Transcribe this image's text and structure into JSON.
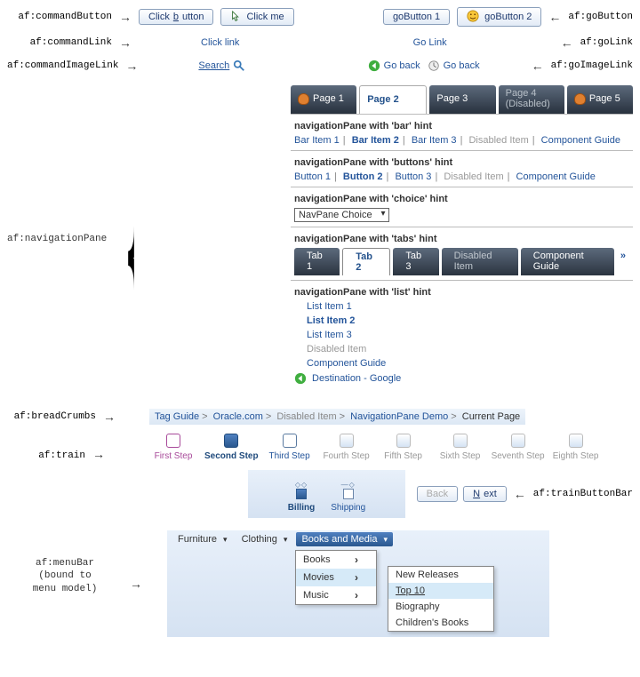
{
  "labels": {
    "commandButton": "af:commandButton",
    "goButton": "af:goButton",
    "commandLink": "af:commandLink",
    "goLink": "af:goLink",
    "commandImageLink": "af:commandImageLink",
    "goImageLink": "af:goImageLink",
    "navigationPane": "af:navigationPane",
    "breadCrumbs": "af:breadCrumbs",
    "train": "af:train",
    "trainButtonBar": "af:trainButtonBar",
    "menuBar_l1": "af:menuBar",
    "menuBar_l2": "(bound to",
    "menuBar_l3": "menu model)"
  },
  "row1": {
    "btn1_pre": "Click ",
    "btn1_u": "b",
    "btn1_post": "utton",
    "btn2": "Click me",
    "gbtn1": "goButton 1",
    "gbtn2": "goButton 2"
  },
  "row2": {
    "clink": "Click link",
    "glink": "Go Link"
  },
  "row3": {
    "search": "Search",
    "goback1": "Go back",
    "goback2": "Go back"
  },
  "globalTabs": {
    "p1": "Page 1",
    "p2": "Page 2",
    "p3": "Page 3",
    "p4": "Page 4 (Disabled)",
    "p5": "Page 5"
  },
  "bar": {
    "title": "navigationPane with 'bar' hint",
    "i1": "Bar Item 1",
    "i2": "Bar Item 2",
    "i3": "Bar Item 3",
    "dis": "Disabled Item",
    "cg": "Component Guide"
  },
  "btns": {
    "title": "navigationPane with 'buttons' hint",
    "i1": "Button 1",
    "i2": "Button 2",
    "i3": "Button 3",
    "dis": "Disabled Item",
    "cg": "Component Guide"
  },
  "choice": {
    "title": "navigationPane with 'choice' hint",
    "sel": "NavPane Choice"
  },
  "tabs": {
    "title": "navigationPane with 'tabs' hint",
    "t1": "Tab 1",
    "t2": "Tab 2",
    "t3": "Tab 3",
    "dis": "Disabled Item",
    "cg": "Component Guide",
    "ov": "»"
  },
  "list": {
    "title": "navigationPane with 'list' hint",
    "i1": "List Item 1",
    "i2": "List Item 2",
    "i3": "List Item 3",
    "dis": "Disabled Item",
    "cg": "Component Guide",
    "dest": "Destination - Google"
  },
  "bc": {
    "a": "Tag Guide",
    "b": "Oracle.com",
    "c": "Disabled Item",
    "d": "NavigationPane Demo",
    "e": "Current Page"
  },
  "trainSteps": {
    "s1": "First Step",
    "s2": "Second Step",
    "s3": "Third Step",
    "s4": "Fourth Step",
    "s5": "Fifth Step",
    "s6": "Sixth Step",
    "s7": "Seventh Step",
    "s8": "Eighth Step"
  },
  "miniTrain": {
    "s1": "Billing",
    "s2": "Shipping"
  },
  "tbb": {
    "back": "Back",
    "next_u": "N",
    "next_post": "ext"
  },
  "menuBar": {
    "m1": "Furniture",
    "m2": "Clothing",
    "m3": "Books and Media",
    "sub1": {
      "a": "Books",
      "b": "Movies",
      "c": "Music"
    },
    "sub2": {
      "a": "New Releases",
      "b": "Top 10",
      "c": "Biography",
      "d": "Children's Books"
    }
  }
}
